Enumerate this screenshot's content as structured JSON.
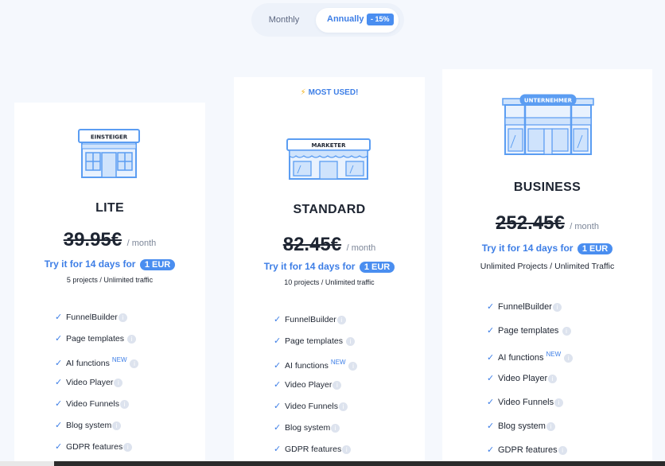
{
  "billing_toggle": {
    "monthly_label": "Monthly",
    "annual_label": "Annually",
    "discount_badge": "- 15%",
    "selected": "Annually"
  },
  "colors": {
    "accent": "#3d7ee6",
    "badge": "#4a8ef0",
    "icon_stroke": "#5b9df2",
    "page_bg": "#f5f8fd"
  },
  "plans": [
    {
      "id": "lite",
      "sign_text": "EINSTEIGER",
      "icon": "storefront-small-icon",
      "name": "LITE",
      "price": "39.95€",
      "per": "/ month",
      "trial_text": "Try it for 14 days for",
      "trial_price": "1 EUR",
      "limits": "5 projects / Unlimited traffic",
      "features": [
        {
          "label": "FunnelBuilder",
          "new": ""
        },
        {
          "label": "Page templates",
          "new": ""
        },
        {
          "label": "AI functions",
          "new": "NEW"
        },
        {
          "label": "Video Player",
          "new": ""
        },
        {
          "label": "Video Funnels",
          "new": ""
        },
        {
          "label": "Blog system",
          "new": ""
        },
        {
          "label": "GDPR features",
          "new": ""
        }
      ]
    },
    {
      "id": "standard",
      "highlight": "MOST USED!",
      "sign_text": "MARKETER",
      "icon": "storefront-medium-icon",
      "name": "STANDARD",
      "price": "82.45€",
      "per": "/ month",
      "trial_text": "Try it for 14 days for",
      "trial_price": "1 EUR",
      "limits": "10 projects / Unlimited traffic",
      "features": [
        {
          "label": "FunnelBuilder",
          "new": ""
        },
        {
          "label": "Page templates",
          "new": ""
        },
        {
          "label": "AI functions",
          "new": "NEW"
        },
        {
          "label": "Video Player",
          "new": ""
        },
        {
          "label": "Video Funnels",
          "new": ""
        },
        {
          "label": "Blog system",
          "new": ""
        },
        {
          "label": "GDPR features",
          "new": ""
        }
      ]
    },
    {
      "id": "business",
      "sign_text": "UNTERNEHMER",
      "icon": "storefront-large-icon",
      "name": "BUSINESS",
      "price": "252.45€",
      "per": "/ month",
      "trial_text": "Try it for 14 days for",
      "trial_price": "1 EUR",
      "limits": "Unlimited Projects / Unlimited Traffic",
      "features": [
        {
          "label": "FunnelBuilder",
          "new": ""
        },
        {
          "label": "Page templates",
          "new": ""
        },
        {
          "label": "AI functions",
          "new": "NEW"
        },
        {
          "label": "Video Player",
          "new": ""
        },
        {
          "label": "Video Funnels",
          "new": ""
        },
        {
          "label": "Blog system",
          "new": ""
        },
        {
          "label": "GDPR features",
          "new": ""
        }
      ]
    }
  ]
}
